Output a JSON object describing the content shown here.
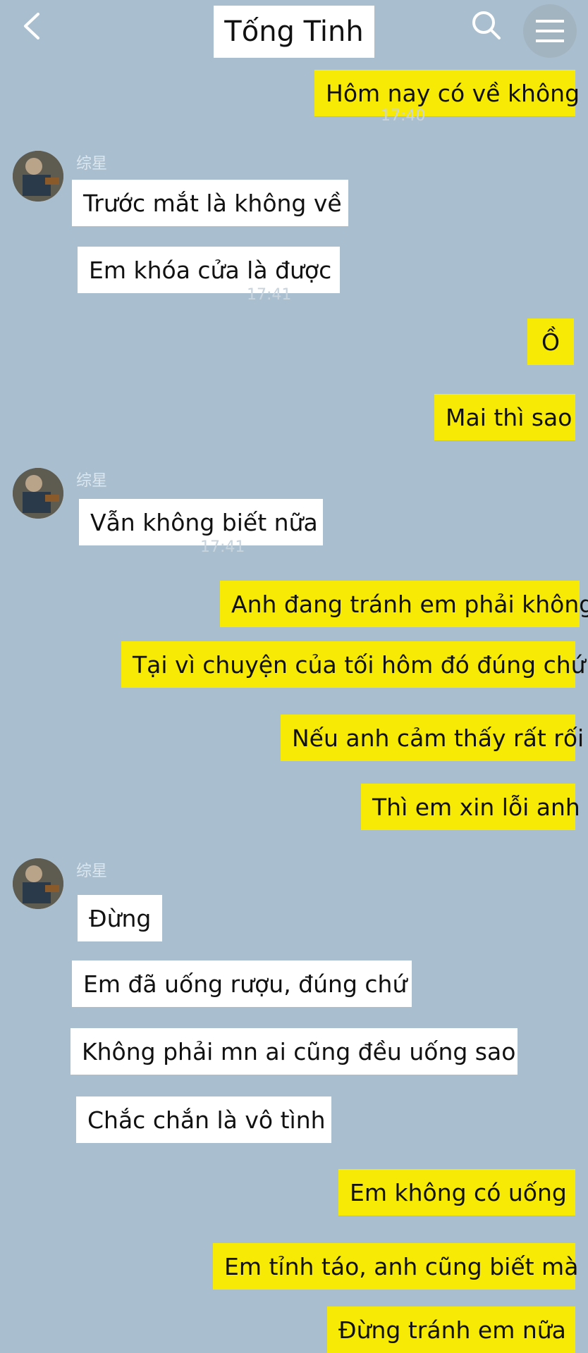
{
  "header": {
    "title": "Tống Tinh"
  },
  "contact": {
    "name": "综星"
  },
  "timestamps": [
    "17:40",
    "17:41",
    "17:41"
  ],
  "messages": [
    "Hôm nay có về không",
    "Trước mắt là không về",
    "Em khóa cửa là được",
    "Ồ",
    "Mai thì sao",
    "Vẫn không biết nữa",
    "Anh đang tránh em phải không",
    "Tại vì chuyện của tối hôm đó đúng chứ",
    "Nếu anh cảm thấy rất rối",
    "Thì em xin lỗi anh",
    "Đừng",
    "Em đã uống rượu, đúng chứ",
    "Không phải mn ai cũng đều uống sao",
    "Chắc chắn là vô tình",
    "Em không có uống",
    "Em tỉnh táo, anh cũng biết mà",
    "Đừng tránh em nữa"
  ],
  "colors": {
    "background": "#a9bfcf",
    "outgoing": "#f7ea05",
    "incoming": "#ffffff"
  },
  "icons": {
    "back": "back-chevron-icon",
    "search": "search-icon",
    "menu": "menu-icon"
  }
}
